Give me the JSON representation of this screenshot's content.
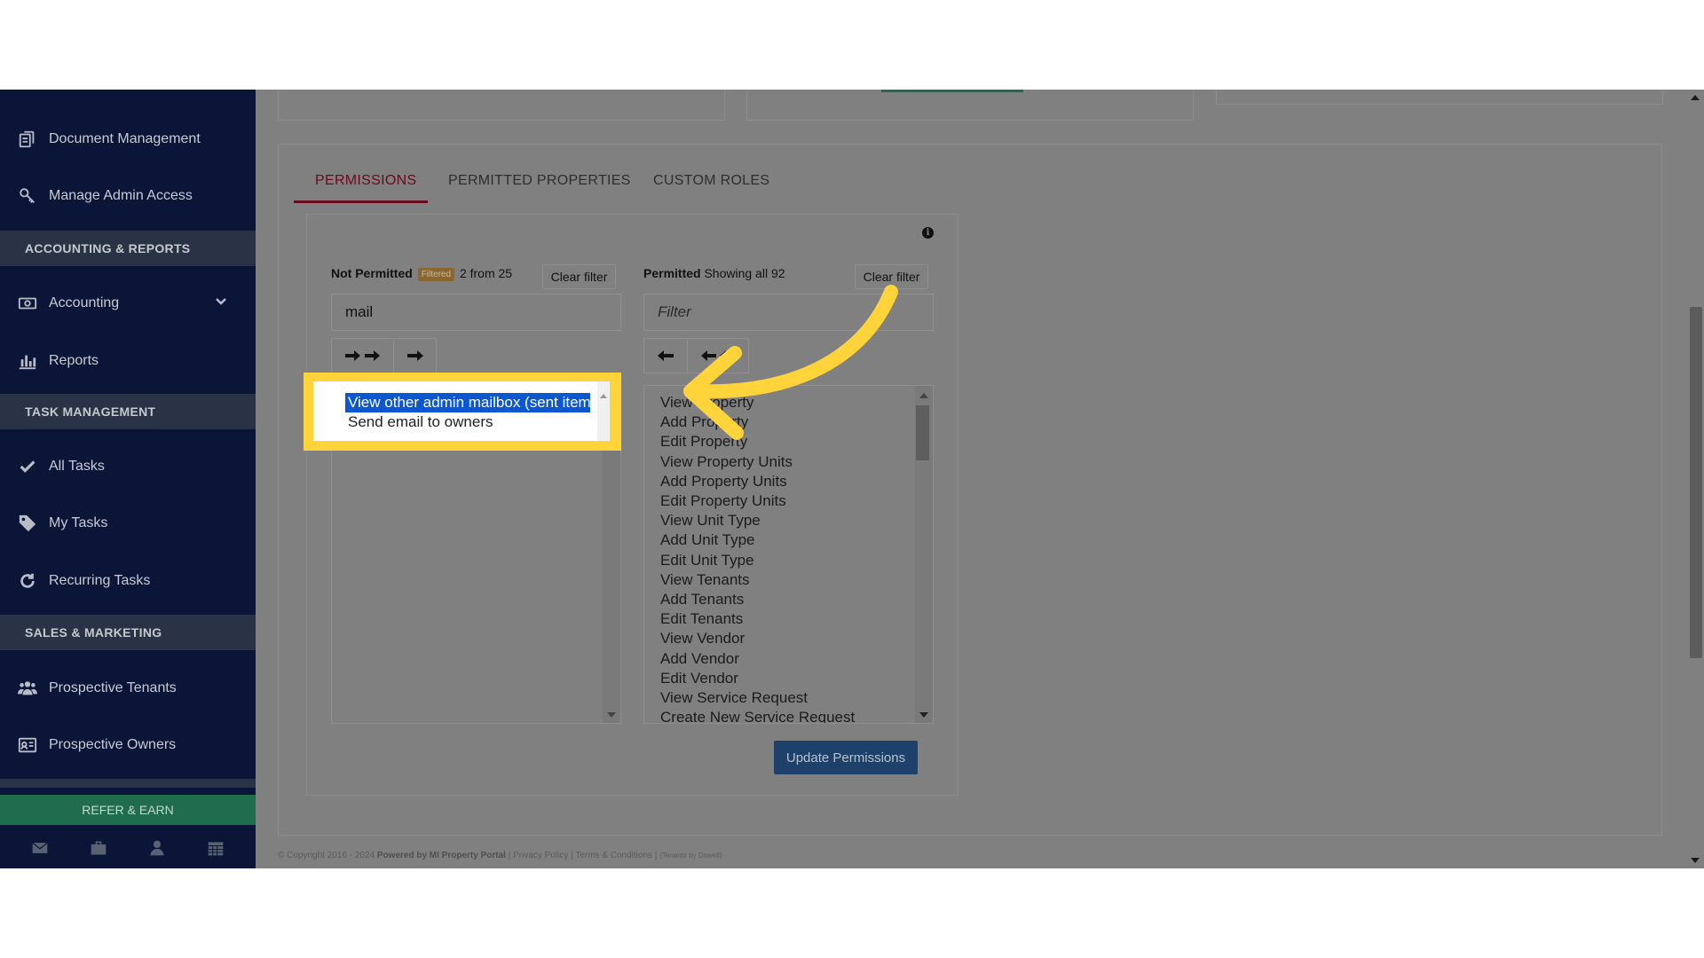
{
  "sidebar": {
    "items": [
      {
        "label": "Document Management",
        "icon": "document-management-icon"
      },
      {
        "label": "Manage Admin Access",
        "icon": "key-icon"
      },
      {
        "label": "Accounting",
        "icon": "money-icon"
      },
      {
        "label": "Reports",
        "icon": "bar-chart-icon"
      },
      {
        "label": "All Tasks",
        "icon": "check-icon"
      },
      {
        "label": "My Tasks",
        "icon": "tag-icon"
      },
      {
        "label": "Recurring Tasks",
        "icon": "refresh-icon"
      },
      {
        "label": "Prospective Tenants",
        "icon": "users-icon"
      },
      {
        "label": "Prospective Owners",
        "icon": "id-card-icon"
      }
    ],
    "sections": {
      "accounting": "ACCOUNTING & REPORTS",
      "tasks": "TASK MANAGEMENT",
      "sales": "SALES & MARKETING"
    },
    "refer_earn": "REFER & EARN",
    "bottom_icons": [
      "mail-icon",
      "briefcase-icon",
      "user-icon",
      "calendar-icon"
    ]
  },
  "tabs": [
    "PERMISSIONS",
    "PERMITTED PROPERTIES",
    "CUSTOM ROLES"
  ],
  "not_permitted": {
    "title": "Not Permitted",
    "badge": "Filtered",
    "count_text": "2 from 25",
    "clear_label": "Clear filter",
    "filter_value": "mail",
    "items": [
      "View other admin mailbox (sent items)",
      "Send email to owners"
    ]
  },
  "permitted": {
    "title": "Permitted",
    "count_text": "Showing all 92",
    "clear_label": "Clear filter",
    "filter_placeholder": "Filter",
    "items": [
      "View Property",
      "Add Property",
      "Edit Property",
      "View Property Units",
      "Add Property Units",
      "Edit Property Units",
      "View Unit Type",
      "Add Unit Type",
      "Edit Unit Type",
      "View Tenants",
      "Add Tenants",
      "Edit Tenants",
      "View Vendor",
      "Add Vendor",
      "Edit Vendor",
      "View Service Request",
      "Create New Service Request"
    ]
  },
  "highlight": {
    "items": [
      "View other admin mailbox (sent items)",
      "Send email to owners"
    ]
  },
  "update_button": "Update Permissions",
  "footer": {
    "copyright": "© Copyright 2016 - 2024",
    "powered": "Powered by MI Property Portal",
    "privacy": "Privacy Policy",
    "terms": "Terms & Conditions",
    "tenants": "(Tenants by Dowell)"
  },
  "colors": {
    "sidebar_bg": "#0b1538",
    "section_bg": "#2a3345",
    "accent_tab": "#6a0a1f",
    "update_btn": "#1d416a",
    "highlight": "#ffd43b",
    "selection": "#0b57d0",
    "refer_earn": "#1f6d4c"
  }
}
